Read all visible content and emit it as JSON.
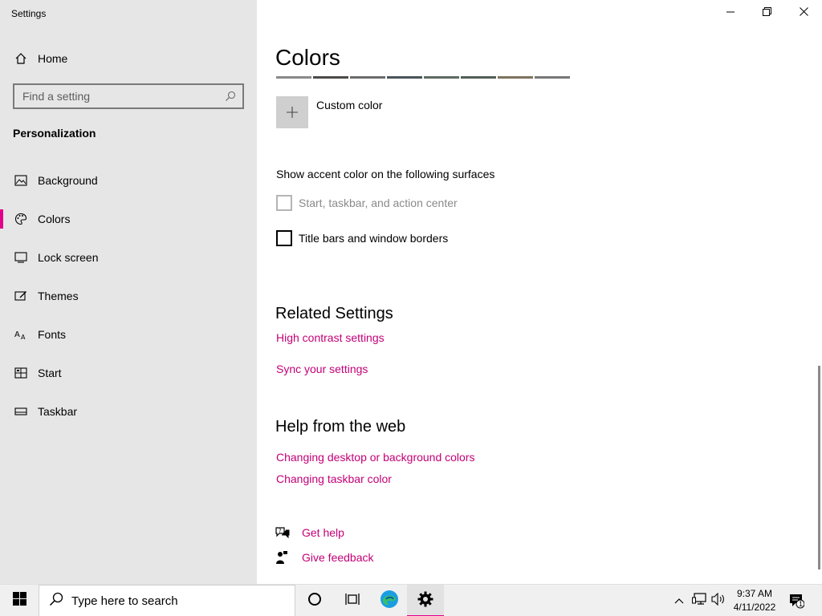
{
  "window": {
    "title": "Settings",
    "controls": {
      "minimize": "minimize-icon",
      "restore": "restore-icon",
      "close": "close-icon"
    }
  },
  "sidebar": {
    "home_label": "Home",
    "search_placeholder": "Find a setting",
    "section_title": "Personalization",
    "items": [
      {
        "label": "Background",
        "icon": "picture-icon",
        "active": false
      },
      {
        "label": "Colors",
        "icon": "palette-icon",
        "active": true
      },
      {
        "label": "Lock screen",
        "icon": "lock-screen-icon",
        "active": false
      },
      {
        "label": "Themes",
        "icon": "themes-icon",
        "active": false
      },
      {
        "label": "Fonts",
        "icon": "fonts-icon",
        "active": false
      },
      {
        "label": "Start",
        "icon": "start-icon",
        "active": false
      },
      {
        "label": "Taskbar",
        "icon": "taskbar-icon",
        "active": false
      }
    ],
    "accent_color": "#e3008c"
  },
  "main": {
    "title": "Colors",
    "swatch_colors": [
      "#8a8a8a",
      "#4c4a48",
      "#6b6b6b",
      "#4a5459",
      "#5d6a62",
      "#525e54",
      "#7e735f",
      "#767676"
    ],
    "custom_color_label": "Custom color",
    "surfaces_label": "Show accent color on the following surfaces",
    "checkboxes": [
      {
        "label": "Start, taskbar, and action center",
        "checked": false,
        "disabled": true
      },
      {
        "label": "Title bars and window borders",
        "checked": false,
        "disabled": false
      }
    ],
    "related": {
      "heading": "Related Settings",
      "links": [
        "High contrast settings",
        "Sync your settings"
      ]
    },
    "help": {
      "heading": "Help from the web",
      "links": [
        "Changing desktop or background colors",
        "Changing taskbar color"
      ]
    },
    "support": {
      "get_help": "Get help",
      "give_feedback": "Give feedback"
    },
    "link_color": "#c30076"
  },
  "taskbar": {
    "search_placeholder": "Type here to search",
    "time": "9:37 AM",
    "date": "4/11/2022",
    "notification_count": "1"
  }
}
